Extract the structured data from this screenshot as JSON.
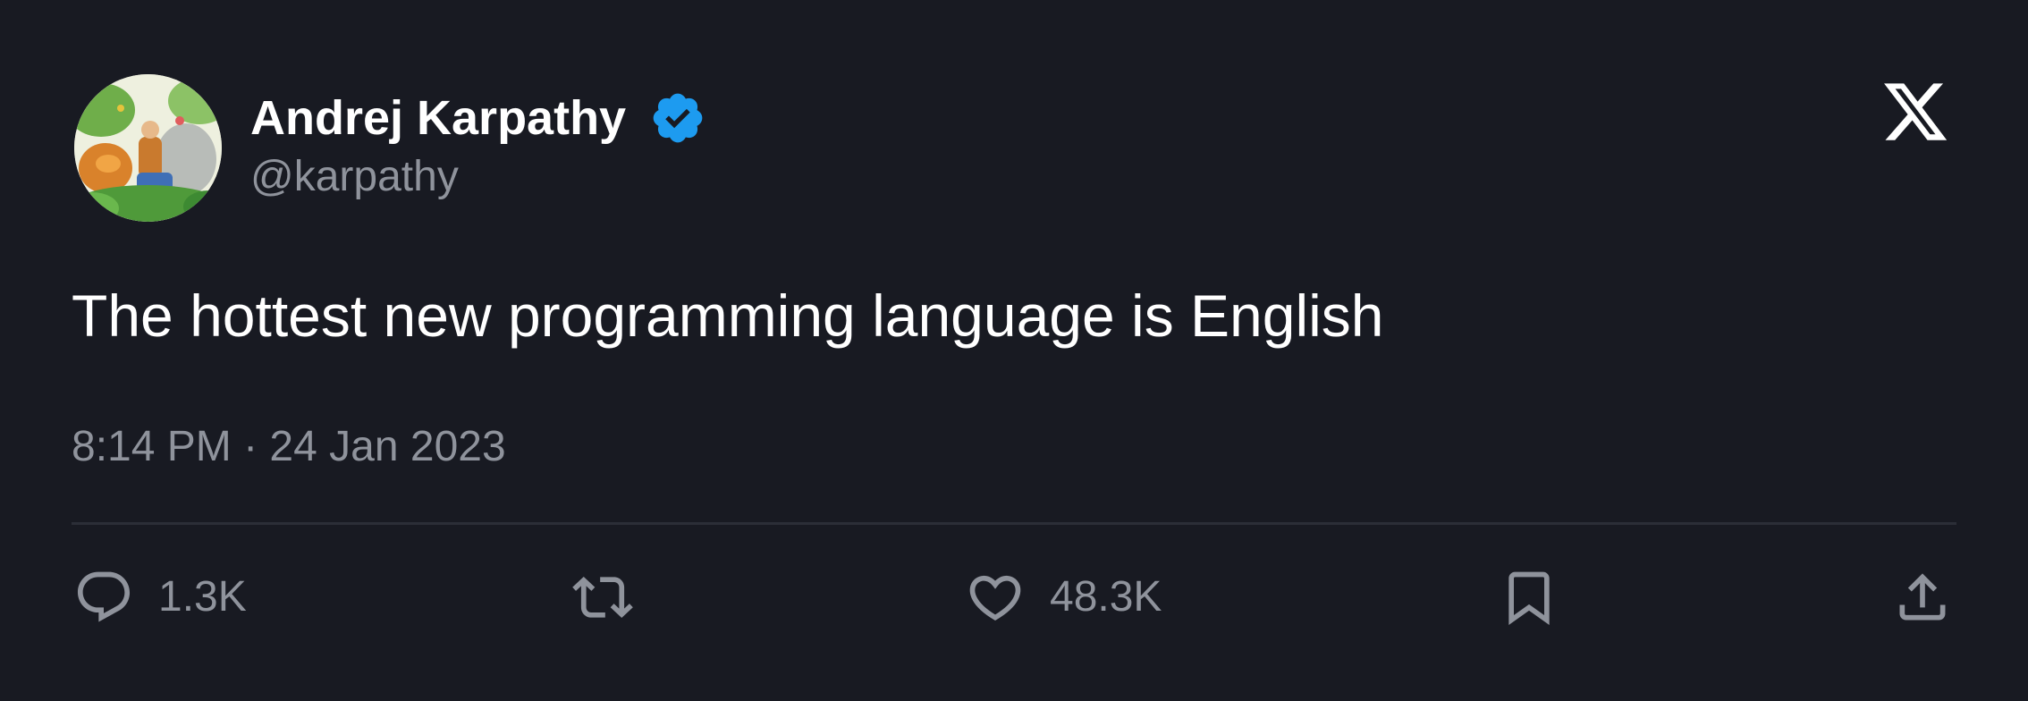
{
  "author": {
    "display_name": "Andrej Karpathy",
    "handle": "@karpathy",
    "verified": true,
    "verified_color": "#1d9bf0"
  },
  "icons": {
    "verified": "verified-badge-icon",
    "platform": "x-logo-icon",
    "reply": "reply-icon",
    "retweet": "retweet-icon",
    "like": "heart-icon",
    "bookmark": "bookmark-icon",
    "share": "share-icon"
  },
  "tweet": {
    "text": "The hottest new programming language is English",
    "timestamp": "8:14 PM · 24 Jan 2023"
  },
  "actions": {
    "reply_count": "1.3K",
    "like_count": "48.3K"
  },
  "colors": {
    "background": "#181a22",
    "text_primary": "#ffffff",
    "text_secondary": "#8f939c",
    "divider": "#2b2e37"
  }
}
